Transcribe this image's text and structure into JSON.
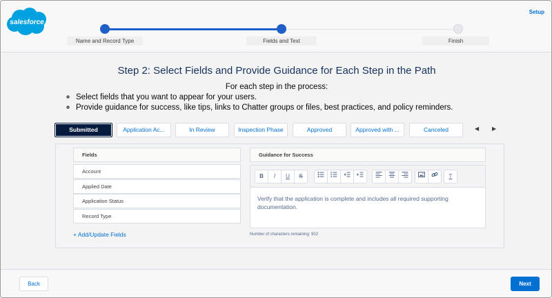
{
  "header": {
    "logo_text": "salesforce",
    "setup_label": "Setup",
    "steps": [
      {
        "label": "Name and Record Type",
        "state": "done"
      },
      {
        "label": "Fields and Text",
        "state": "current"
      },
      {
        "label": "Finish",
        "state": "todo"
      }
    ]
  },
  "main": {
    "title": "Step 2: Select Fields and Provide Guidance for Each Step in the Path",
    "subtitle": "For each step in the process:",
    "bullets": [
      "Select fields that you want to appear for your users.",
      "Provide guidance for success, like tips, links to Chatter groups or files, best practices, and policy reminders."
    ]
  },
  "stages": {
    "items": [
      {
        "label": "Submitted",
        "selected": true
      },
      {
        "label": "Application Ac...",
        "selected": false
      },
      {
        "label": "In Review",
        "selected": false
      },
      {
        "label": "Inspection Phase",
        "selected": false
      },
      {
        "label": "Approved",
        "selected": false
      },
      {
        "label": "Approved with ...",
        "selected": false
      },
      {
        "label": "Canceled",
        "selected": false
      }
    ],
    "prev_icon": "triangle-left",
    "next_icon": "triangle-right"
  },
  "fields_panel": {
    "header": "Fields",
    "rows": [
      "Account",
      "Applied Date",
      "Application Status",
      "Record Type"
    ],
    "add_link": "+ Add/Update Fields"
  },
  "guidance_panel": {
    "header": "Guidance for Success",
    "text": "Verify that the application is complete and includes all required supporting documentation.",
    "chars_remaining": "Number of characters remaining: 902"
  },
  "toolbar": {
    "bold": "B",
    "italic": "I",
    "underline": "U",
    "strike": "S",
    "clear": "T"
  },
  "footer": {
    "back_label": "Back",
    "next_label": "Next"
  },
  "colors": {
    "brand": "#0070d2",
    "progress": "#1f5fc6",
    "selected_stage": "#061c3f",
    "logo_cloud": "#00a1e0"
  }
}
